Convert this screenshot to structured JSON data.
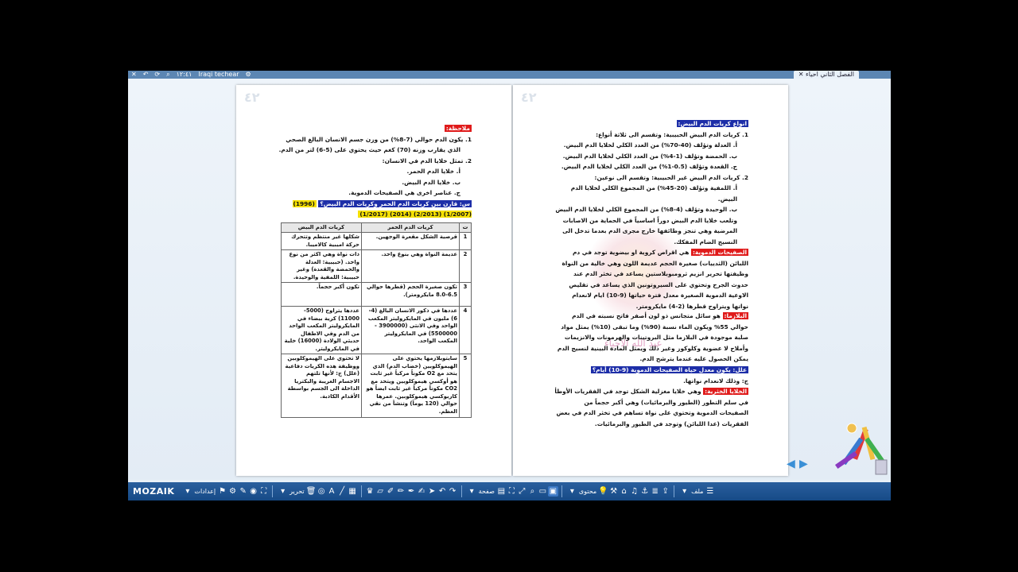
{
  "titlebar": {
    "app_label": "Iraqi techear",
    "tab_name": "الفصل الثاني احياء",
    "time": "١٢:٤١"
  },
  "page_left": {
    "page_number": "٤٢",
    "note_label": "ملاحظة:",
    "lines": [
      "1. يكون الدم حوالي (7-8%) من وزن جسم الانسان البالغ الصحي",
      "الذي يقارب وزنه (70) كغم حيث يحتوي على (5-6) لتر من الدم.",
      "2. تمثل خلايا الدم في الانسان:",
      "أ. خلايا الدم الحمر.",
      "ب. خلايا الدم البيض.",
      "ج. عناصر اخرى هي الصفيحات الدموية."
    ],
    "question": "س: قارن بين كريات الدم الحمر وكريات الدم البيض؟",
    "years": "(1996) (1/2007) (2/2013) (2014) (1/2017)",
    "table": {
      "headers": [
        "ت",
        "كريات الدم الحمر",
        "كريات الدم البيض"
      ],
      "rows": [
        {
          "n": "1",
          "red": "قرصية الشكل مقعرة الوجهين.",
          "white": "شكلها غير منتظم وتتحرك حركة اميبية كالاميبا."
        },
        {
          "n": "2",
          "red": "عديمة النواة وهي بنوع واحد.",
          "white": "ذات نواة وهي اكثر من نوع واحد. (حبيبية: العدلة والحمضة والقعدة) وغير حبيبية: اللمفية والوحيدة."
        },
        {
          "n": "3",
          "red": "تكون صغيرة الحجم (قطرها حوالي 6.5-8.0 مايكرومتر).",
          "white": "تكون أكبر حجماً."
        },
        {
          "n": "4",
          "red": "عددها في ذكور الانسان البالغ (4-6) مليون في المايكروليتر المكعب الواحد وفي الانثى (3900000 - 5500000) في المايكروليتر المكعب الواحد.",
          "white": "عددها يتراوح (5000-11000) كرية بيضاء في المايكروليتر المكعب الواحد من الدم وفي الاطفال حديثي الولادة (16000) خلية في المايكروليتر."
        },
        {
          "n": "5",
          "red": "سايتوبلازمها يحتوي على الهيموكلوبين (خضاب الدم) الذي يتحد مع O2 مكوناً مركباً غير ثابت هو أوكسي هيموكلوبين ويتحد مع CO2 مكوناً مركباً غير ثابت ايضاً هو كاربوكسي هيموكلوبين. عمرها حوالي (120 يوماً) وتنشأ من نقي العظم.",
          "white": "لا تحتوي على الهيموكلوبين ووظيفة هذه الكريات دفاعية (علل) ج: لأنها تلتهم الاجسام الغريبة والبكتريا الداخلة الى الجسم بواسطة الأقدام الكاذبة."
        }
      ]
    }
  },
  "page_right": {
    "page_number": "٤٢",
    "heading": "انواع كريات الدم البيض:",
    "lines": [
      "1. كريات الدم البيض الحبيبية: وتقسم الى ثلاثة أنواع:",
      "أ. العدلة وتؤلف (40-70%) من العدد الكلي لخلايا الدم البيض.",
      "ب. الحمضة وتؤلف (1-4%) من العدد الكلي لخلايا الدم البيض.",
      "ج. القعدة وتؤلف (0.5-1%) من العدد الكلي لخلايا الدم البيض.",
      "2. كريات الدم البيض غير الحبيبية: وتقسم الى نوعين:",
      "أ. اللمفية وتؤلف (20-45%) من المجموع الكلي لخلايا الدم البيض.",
      "ب. الوحيدة وتؤلف (4-8%) من المجموع الكلي لخلايا الدم البيض",
      "وتلعب خلايا الدم البيض دوراً اساسياً في الحماية من الاصابات",
      "المرضية وهي تنجز وظائفها خارج مجرى الدم بعدما تدخل الى",
      "النسيج الضام المفكك."
    ],
    "platelets_label": "الصفيحات الدموية:",
    "platelets_text": "هي اقراص كروية او بيضوية توجد في دم اللبائن (الثدييات) صغيرة الحجم عديمة اللون وهي خالية من النواة وظيفتها تحرير انزيم ثرومبوبلاستين يساعد في تخثر الدم عند حدوث الجرح وتحتوي على السيروتونين الذي يساعد في تقليص الاوعية الدموية الصغيرة معدل فترة حياتها (9-10) ايام لانعدام نواتها ويتراوح قطرها (2-4) مايكرومتر.",
    "plasma_label": "البلازما:",
    "plasma_text": "هو سائل متجانس ذو لون أصفر فاتح نسبته في الدم حوالي 55% ويكون الماء نسبة (90%) وما تبقى (10%) يمثل مواد صلبة موجودة في البلازما مثل البروتينات والهرمونات والانزيمات وأملاح لا عضوية وكلوكوز وغير ذلك ويمثل المادة البينية لنسيج الدم يمكن الحصول عليه عندما يترشح الدم.",
    "reason_label": "علل: يكون معدل حياة الصفيحات الدموية (9-10) أيام؟",
    "reason_answer": "ج: وذلك لانعدام نواتها.",
    "spindle_label": "الخلايا الخثرية:",
    "spindle_text": "وهي خلايا مغزلية الشكل توجد في الفقريات الأوطأ في سلم التطور (الطيور والبرمائيات) وهي أكبر حجماً من الصفيحات الدموية وتحتوي على نواة تساهم في تخثر الدم في بعض الفقريات (عدا اللبائن) وتوجد في الطيور والبرمائيات.",
    "watermark_text": "عبد الله الاحياء"
  },
  "toolbar": {
    "logo": "MOZAIK",
    "settings_label": "إعدادات",
    "edit_label": "تحرير",
    "page_label": "صفحة",
    "content_label": "محتوى",
    "file_label": "ملف"
  },
  "colors": {
    "toolbar": "#164a86",
    "highlight_red": "#e01b1b",
    "highlight_blue": "#1d2ea8",
    "highlight_yellow": "#f5e000"
  }
}
